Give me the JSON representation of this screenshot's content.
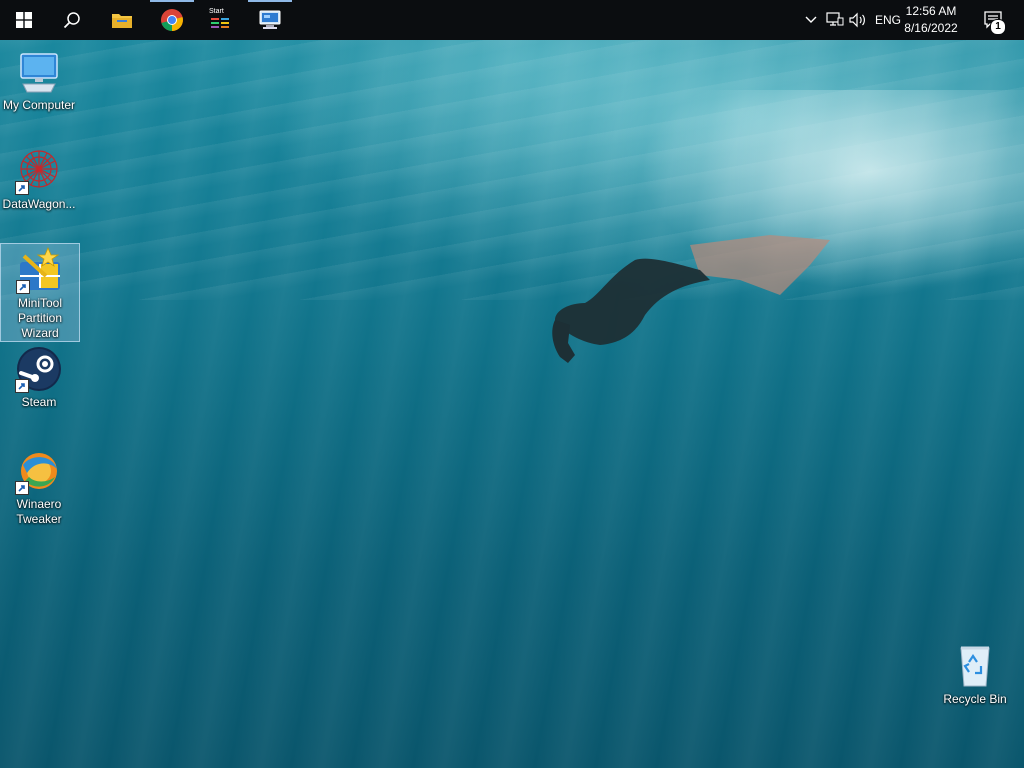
{
  "taskbar": {
    "pinned": [
      {
        "name": "start",
        "icon": "windows-logo-icon"
      },
      {
        "name": "search",
        "icon": "search-icon"
      },
      {
        "name": "file-explorer",
        "icon": "folder-icon"
      },
      {
        "name": "chrome",
        "icon": "chrome-icon"
      },
      {
        "name": "start-app",
        "label": "Start",
        "icon": "start-app-icon"
      },
      {
        "name": "remote-desktop",
        "icon": "remote-desktop-icon"
      }
    ],
    "tray": {
      "language": "ENG",
      "time": "12:56 AM",
      "date": "8/16/2022",
      "notification_count": "1"
    }
  },
  "desktop": {
    "icons": [
      {
        "label": "My Computer",
        "icon": "computer-icon"
      },
      {
        "label": "DataWagon...",
        "icon": "datawagon-icon"
      },
      {
        "label": "MiniTool Partition Wizard",
        "icon": "minitool-icon",
        "selected": true
      },
      {
        "label": "Steam",
        "icon": "steam-icon"
      },
      {
        "label": "Winaero Tweaker",
        "icon": "winaero-icon"
      },
      {
        "label": "Recycle Bin",
        "icon": "recycle-bin-icon"
      }
    ]
  },
  "colors": {
    "taskbar": "#0b0d10",
    "water_top": "#1b8aa0",
    "water_bottom": "#0a566c"
  }
}
